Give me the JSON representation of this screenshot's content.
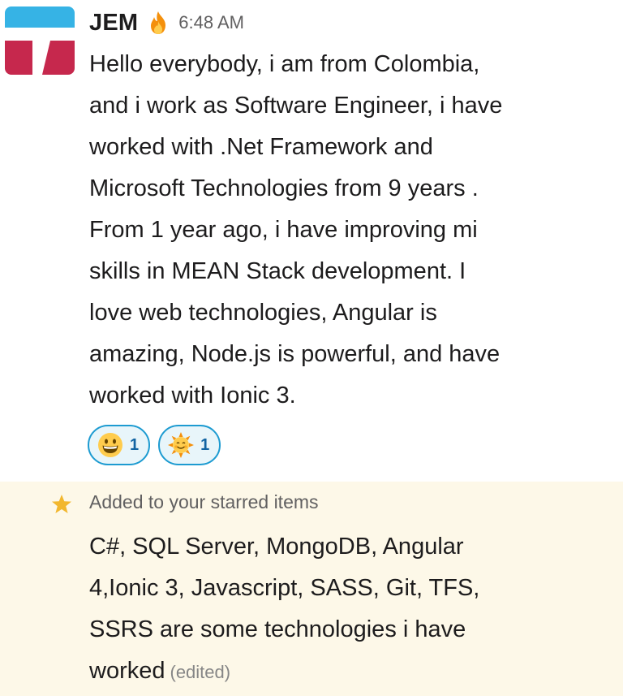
{
  "message": {
    "author": "JEM",
    "status_emoji": "fire-icon",
    "timestamp": "6:48 AM",
    "body_lines": [
      "Hello everybody, i am from Colombia,",
      "and i work as Software Engineer, i have",
      "worked with .Net Framework and",
      "Microsoft Technologies from 9 years .",
      "From 1 year ago, i have improving mi",
      "skills in MEAN Stack development. I",
      "love web technologies, Angular is",
      "amazing, Node.js is powerful, and have",
      "worked with Ionic 3."
    ],
    "reactions": [
      {
        "emoji": "grinning-face-icon",
        "count": "1"
      },
      {
        "emoji": "sun-with-face-icon",
        "count": "1"
      }
    ]
  },
  "starred": {
    "label": "Added to your starred items",
    "body_lines": [
      "C#, SQL Server, MongoDB, Angular",
      "4,Ionic 3, Javascript, SASS, Git, TFS,",
      "SSRS are some technologies i have",
      "worked"
    ],
    "edited_label": "(edited)"
  },
  "colors": {
    "avatar_blue": "#36b3e5",
    "avatar_red": "#c6284d",
    "reaction_border": "#1d9bd1",
    "reaction_bg": "#e8f5fa",
    "starred_bg": "#fdf8e8",
    "star": "#f2b72e"
  }
}
